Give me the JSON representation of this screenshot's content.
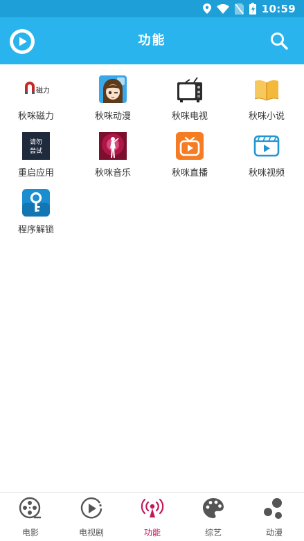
{
  "status_bar": {
    "time": "10:59"
  },
  "app_bar": {
    "title": "功能"
  },
  "features": [
    {
      "label": "秋咪磁力",
      "icon": "magnet-icon"
    },
    {
      "label": "秋咪动漫",
      "icon": "anime-girl-icon"
    },
    {
      "label": "秋咪电视",
      "icon": "tv-icon"
    },
    {
      "label": "秋咪小说",
      "icon": "book-icon"
    },
    {
      "label": "重启应用",
      "icon": "restart-icon",
      "icon_text": "请勿尝试"
    },
    {
      "label": "秋咪音乐",
      "icon": "music-icon"
    },
    {
      "label": "秋咪直播",
      "icon": "live-icon"
    },
    {
      "label": "秋咪视频",
      "icon": "video-icon"
    },
    {
      "label": "程序解锁",
      "icon": "key-icon"
    }
  ],
  "magnet_icon_text": "磁力",
  "bottom_nav": [
    {
      "label": "电影",
      "icon": "film-reel-icon",
      "active": false
    },
    {
      "label": "电视剧",
      "icon": "play-circle-icon",
      "active": false
    },
    {
      "label": "功能",
      "icon": "broadcast-icon",
      "active": true
    },
    {
      "label": "综艺",
      "icon": "palette-icon",
      "active": false
    },
    {
      "label": "动漫",
      "icon": "dots-icon",
      "active": false
    }
  ],
  "colors": {
    "status_bar": "#1e9fd8",
    "app_bar": "#29b4ee",
    "active_tab": "#c2185b",
    "nav_icon": "#555555"
  }
}
